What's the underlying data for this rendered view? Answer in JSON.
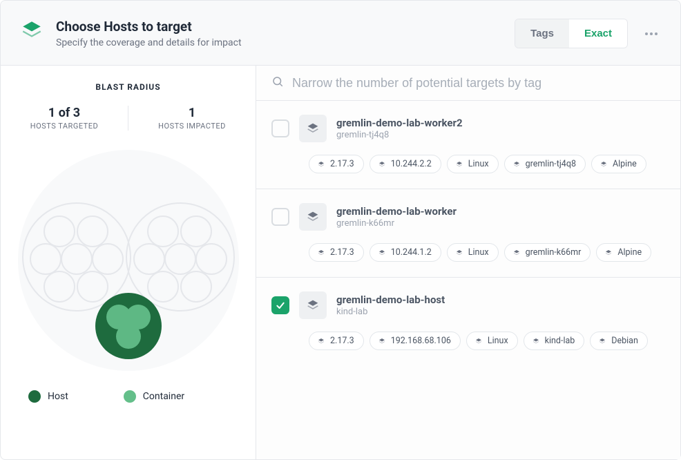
{
  "header": {
    "title": "Choose Hosts to target",
    "subtitle": "Specify the coverage and details for impact"
  },
  "toggle": {
    "tags_label": "Tags",
    "exact_label": "Exact"
  },
  "blast": {
    "title": "BLAST RADIUS",
    "targeted_num": "1 of 3",
    "targeted_label": "HOSTS TARGETED",
    "impacted_num": "1",
    "impacted_label": "HOSTS IMPACTED"
  },
  "legend": {
    "host_label": "Host",
    "container_label": "Container",
    "host_color": "#1e6b3e",
    "container_color": "#64bf8a"
  },
  "search": {
    "placeholder": "Narrow the number of potential targets by tag"
  },
  "hosts": [
    {
      "name": "gremlin-demo-lab-worker2",
      "sub": "gremlin-tj4q8",
      "checked": false,
      "tags": [
        "2.17.3",
        "10.244.2.2",
        "Linux",
        "gremlin-tj4q8",
        "Alpine"
      ]
    },
    {
      "name": "gremlin-demo-lab-worker",
      "sub": "gremlin-k66mr",
      "checked": false,
      "tags": [
        "2.17.3",
        "10.244.1.2",
        "Linux",
        "gremlin-k66mr",
        "Alpine"
      ]
    },
    {
      "name": "gremlin-demo-lab-host",
      "sub": "kind-lab",
      "checked": true,
      "tags": [
        "2.17.3",
        "192.168.68.106",
        "Linux",
        "kind-lab",
        "Debian"
      ]
    }
  ],
  "colors": {
    "brand_green": "#1ba36a"
  }
}
